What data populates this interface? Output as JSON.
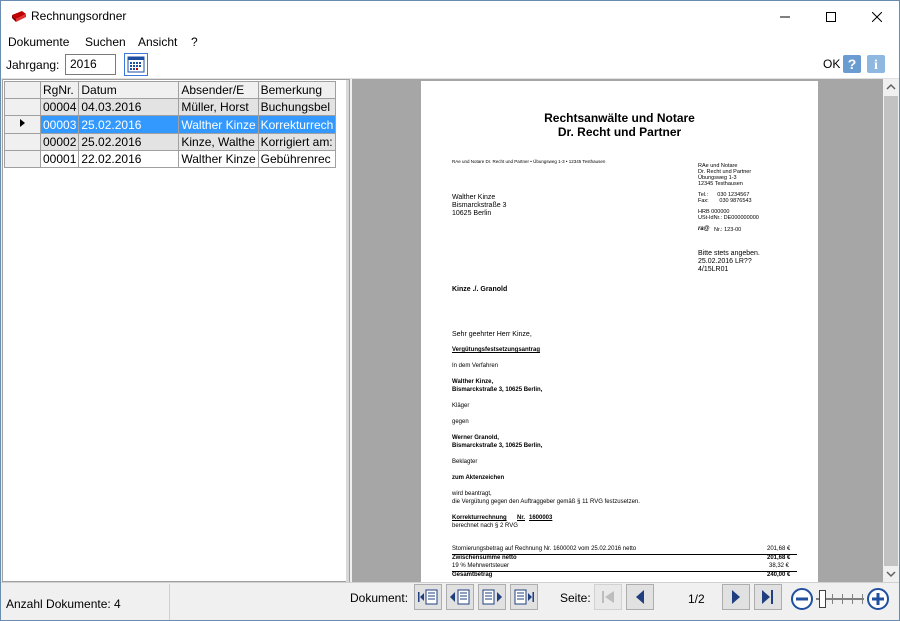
{
  "window": {
    "title": "Rechnungsordner"
  },
  "menu": [
    "Dokumente",
    "Suchen",
    "Ansicht",
    "?"
  ],
  "toolbar": {
    "year_label": "Jahrgang:",
    "year_value": "2016",
    "ok_label": "OK"
  },
  "grid": {
    "columns": [
      "RgNr.",
      "Datum",
      "Absender/E",
      "Bemerkung"
    ],
    "rows": [
      {
        "nr": "00004",
        "date": "04.03.2016",
        "sender": "Müller, Horst",
        "note": "Buchungsbel"
      },
      {
        "nr": "00003",
        "date": "25.02.2016",
        "sender": "Walther Kinze",
        "note": "Korrekturrech"
      },
      {
        "nr": "00002",
        "date": "25.02.2016",
        "sender": "Kinze, Walthe",
        "note": "Korrigiert am:"
      },
      {
        "nr": "00001",
        "date": "22.02.2016",
        "sender": "Walther Kinze",
        "note": "Gebührenrec"
      }
    ],
    "selected_row": 1
  },
  "document": {
    "firm_line1": "Rechtsanwälte und Notare",
    "firm_line2": "Dr. Recht und Partner",
    "sender_line": "RAe und Notare Dr. Recht und Partner • Übungsweg 1-3 • 12345 Testhausen",
    "side": [
      "RAe und Notare",
      "Dr. Recht und Partner",
      "Übungsweg 1-3",
      "12345 Testhausen"
    ],
    "tel": "Tel.:      030 1234567",
    "fax": "Fax:       030 9876543",
    "hrb": "HRB 000000",
    "ust": "USt-IdNr.: DE000000000",
    "ra_nr": "Nr.: 123-00",
    "address": [
      "Walther Kinze",
      "Bismarckstraße 3",
      "10625 Berlin"
    ],
    "ref": [
      "Bitte stets angeben.",
      "25.02.2016 LR??",
      "4/15LR01"
    ],
    "subject": "Kinze ./. Granold",
    "salutation": "Sehr geehrter Herr Kinze,",
    "heading": "Vergütungsfestsetzungsantrag",
    "in_dem": "In dem Verfahren",
    "plaintiff": [
      "Walther Kinze,",
      "Bismarckstraße 3, 10625 Berlin,"
    ],
    "klaeger": "Kläger",
    "gegen": "gegen",
    "defendant": [
      "Werner Granold,",
      "Bismarckstraße 3, 10625 Berlin,"
    ],
    "beklagter": "Beklagter",
    "zum": "zum Aktenzeichen",
    "request": [
      "wird beantragt,",
      "die Vergütung gegen den Auftraggeber gemäß § 11 RVG festzusetzen."
    ],
    "corr_title": "Korrekturrechnung",
    "corr_nr_label": "Nr.",
    "corr_nr": "1600003",
    "corr_sub": "berechnet nach § 2 RVG",
    "lines": [
      {
        "label": "Stornierungsbetrag auf Rechnung Nr. 1600002 vom 25.02.2016 netto",
        "value": "201,68 €"
      },
      {
        "label": "Zwischensumme netto",
        "value": "201,68 €"
      },
      {
        "label": "19 % Mehrwertsteuer",
        "value": "38,32 €"
      },
      {
        "label": "Gesamtbetrag",
        "value": "240,00 €"
      }
    ]
  },
  "status": {
    "count": "Anzahl Dokumente: 4",
    "doc_label": "Dokument:",
    "page_label": "Seite:",
    "page": "1/2"
  }
}
